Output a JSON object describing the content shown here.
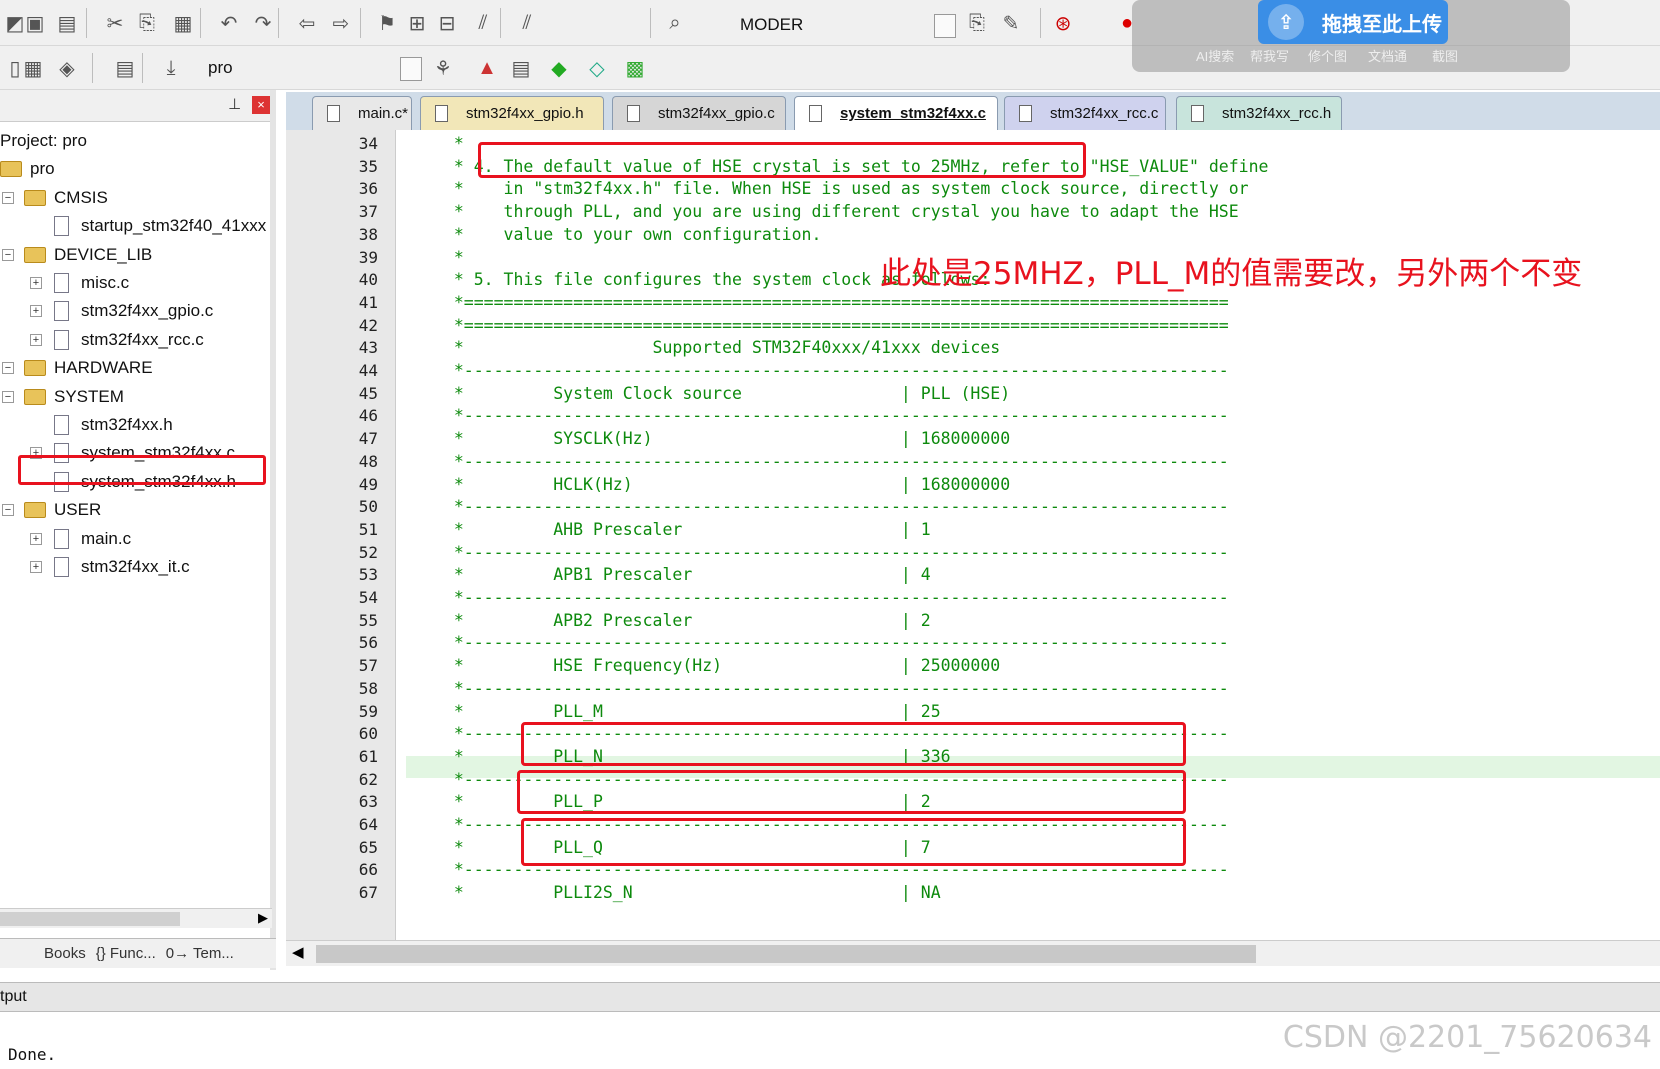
{
  "toolbar": {
    "target_combo": "MODER",
    "project_combo": "pro",
    "icons": [
      "new-file-icon",
      "save-icon",
      "save-all-icon",
      "cut-icon",
      "copy-icon",
      "paste-icon",
      "undo-icon",
      "redo-icon",
      "nav-back-icon",
      "nav-forward-icon",
      "bookmark-icon",
      "indent-icon",
      "outdent-icon",
      "comment-icon",
      "uncomment-icon",
      "find-in-files-icon",
      "build-icon",
      "debug-icon",
      "breakpoint-icon",
      "load-icon"
    ]
  },
  "overlay": {
    "upload_label": "拖拽至此上传",
    "items": [
      "AI搜索",
      "帮我写",
      "修个图",
      "文档通",
      "截图"
    ]
  },
  "project_panel": {
    "root_label": "Project: pro",
    "target": "pro",
    "groups": [
      {
        "name": "CMSIS",
        "files": [
          "startup_stm32f40_41xxx"
        ]
      },
      {
        "name": "DEVICE_LIB",
        "files": [
          "misc.c",
          "stm32f4xx_gpio.c",
          "stm32f4xx_rcc.c"
        ]
      },
      {
        "name": "HARDWARE",
        "files": []
      },
      {
        "name": "SYSTEM",
        "files": [
          "stm32f4xx.h",
          "system_stm32f4xx.c",
          "system_stm32f4xx.h"
        ]
      },
      {
        "name": "USER",
        "files": [
          "main.c",
          "stm32f4xx_it.c"
        ]
      }
    ],
    "bottom_tabs": [
      "Books",
      "{} Func...",
      "0→ Tem..."
    ]
  },
  "editor_tabs": [
    {
      "label": "main.c*",
      "active": false,
      "color": "#e8e8e8"
    },
    {
      "label": "stm32f4xx_gpio.h",
      "active": false,
      "color": "#f2e7b8"
    },
    {
      "label": "stm32f4xx_gpio.c",
      "active": false,
      "color": "#d6d6d6"
    },
    {
      "label": "system_stm32f4xx.c",
      "active": true,
      "color": "#ffffff"
    },
    {
      "label": "stm32f4xx_rcc.c",
      "active": false,
      "color": "#cfd2ee"
    },
    {
      "label": "stm32f4xx_rcc.h",
      "active": false,
      "color": "#c8e4dc"
    }
  ],
  "code_lines": [
    {
      "n": "34",
      "text": "  *"
    },
    {
      "n": "35",
      "text": "  * 4. The default value of HSE crystal is set to 25MHz, refer to \"HSE_VALUE\" define"
    },
    {
      "n": "36",
      "text": "  *    in \"stm32f4xx.h\" file. When HSE is used as system clock source, directly or"
    },
    {
      "n": "37",
      "text": "  *    through PLL, and you are using different crystal you have to adapt the HSE"
    },
    {
      "n": "38",
      "text": "  *    value to your own configuration."
    },
    {
      "n": "39",
      "text": "  *"
    },
    {
      "n": "40",
      "text": "  * 5. This file configures the system clock as follows:"
    },
    {
      "n": "41",
      "text": "  *============================================================================="
    },
    {
      "n": "42",
      "text": "  *============================================================================="
    },
    {
      "n": "43",
      "text": "  *                   Supported STM32F40xxx/41xxx devices"
    },
    {
      "n": "44",
      "text": "  *-----------------------------------------------------------------------------"
    },
    {
      "n": "45",
      "text": "  *         System Clock source                | PLL (HSE)"
    },
    {
      "n": "46",
      "text": "  *-----------------------------------------------------------------------------"
    },
    {
      "n": "47",
      "text": "  *         SYSCLK(Hz)                         | 168000000"
    },
    {
      "n": "48",
      "text": "  *-----------------------------------------------------------------------------"
    },
    {
      "n": "49",
      "text": "  *         HCLK(Hz)                           | 168000000"
    },
    {
      "n": "50",
      "text": "  *-----------------------------------------------------------------------------"
    },
    {
      "n": "51",
      "text": "  *         AHB Prescaler                      | 1"
    },
    {
      "n": "52",
      "text": "  *-----------------------------------------------------------------------------"
    },
    {
      "n": "53",
      "text": "  *         APB1 Prescaler                     | 4"
    },
    {
      "n": "54",
      "text": "  *-----------------------------------------------------------------------------"
    },
    {
      "n": "55",
      "text": "  *         APB2 Prescaler                     | 2"
    },
    {
      "n": "56",
      "text": "  *-----------------------------------------------------------------------------"
    },
    {
      "n": "57",
      "text": "  *         HSE Frequency(Hz)                  | 25000000"
    },
    {
      "n": "58",
      "text": "  *-----------------------------------------------------------------------------"
    },
    {
      "n": "59",
      "text": "  *         PLL_M                              | 25"
    },
    {
      "n": "60",
      "text": "  *-----------------------------------------------------------------------------"
    },
    {
      "n": "61",
      "text": "  *         PLL_N                              | 336"
    },
    {
      "n": "62",
      "text": "  *-----------------------------------------------------------------------------"
    },
    {
      "n": "63",
      "text": "  *         PLL_P                              | 2"
    },
    {
      "n": "64",
      "text": "  *-----------------------------------------------------------------------------"
    },
    {
      "n": "65",
      "text": "  *         PLL_Q                              | 7"
    },
    {
      "n": "66",
      "text": "  *-----------------------------------------------------------------------------"
    },
    {
      "n": "67",
      "text": "  *         PLLI2S_N                           | NA"
    }
  ],
  "annotation": "此处是25MHZ，PLL_M的值需要改，另外两个不变",
  "output": {
    "title": "tput",
    "text": "Done."
  },
  "watermark": "CSDN @2201_75620634"
}
